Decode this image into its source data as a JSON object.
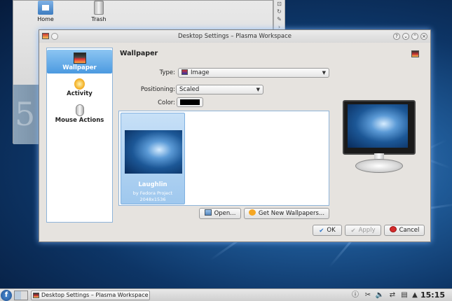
{
  "desktop": {
    "icons": [
      {
        "label": "Home"
      },
      {
        "label": "Trash"
      }
    ],
    "wallpaper_text": "5"
  },
  "dialog": {
    "title": "Desktop Settings – Plasma Workspace",
    "sidebar": {
      "items": [
        {
          "label": "Wallpaper",
          "icon": "wallpaper-icon",
          "active": true
        },
        {
          "label": "Activity",
          "icon": "activity-icon",
          "active": false
        },
        {
          "label": "Mouse Actions",
          "icon": "mouse-icon",
          "active": false
        }
      ]
    },
    "section_title": "Wallpaper",
    "form": {
      "type_label": "Type:",
      "type_value": "Image",
      "positioning_label": "Positioning:",
      "positioning_value": "Scaled",
      "color_label": "Color:",
      "color_value": "#000000"
    },
    "gallery": {
      "items": [
        {
          "name": "Laughlin",
          "author": "by Fedora Project",
          "size": "2048x1536",
          "selected": true
        }
      ]
    },
    "buttons": {
      "open": "Open...",
      "get_new": "Get New Wallpapers...",
      "ok": "OK",
      "apply": "Apply",
      "cancel": "Cancel"
    }
  },
  "taskbar": {
    "task_label": "Desktop Settings – Plasma Workspace",
    "clock": "15:15"
  },
  "colors": {
    "selection": "#4c9ae0",
    "desktop_bg": "#1f5a97",
    "dialog_bg": "#e6e3df"
  }
}
